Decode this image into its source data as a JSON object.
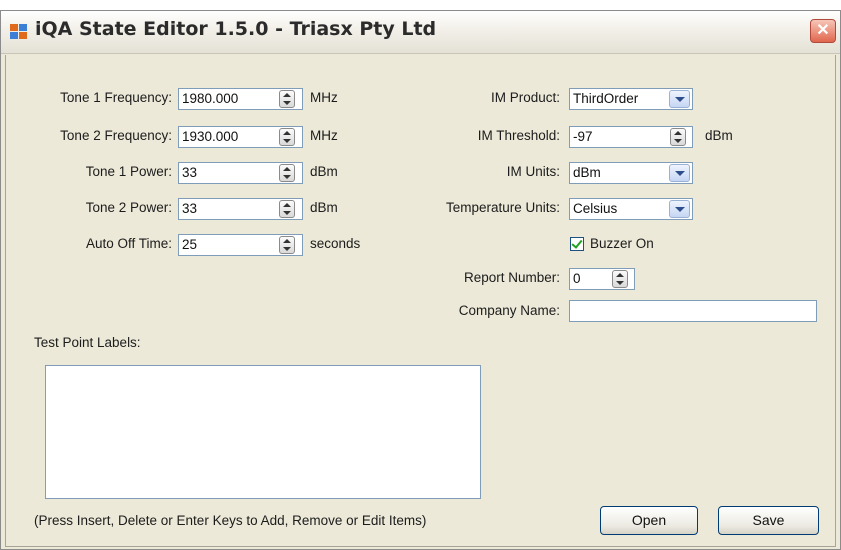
{
  "window": {
    "title": "iQA State Editor 1.5.0 - Triasx Pty Ltd",
    "close_glyph": "✕"
  },
  "left_fields": [
    {
      "label": "Tone 1 Frequency:",
      "value": "1980.000",
      "unit": "MHz"
    },
    {
      "label": "Tone 2 Frequency:",
      "value": "1930.000",
      "unit": "MHz"
    },
    {
      "label": "Tone 1 Power:",
      "value": "33",
      "unit": "dBm"
    },
    {
      "label": "Tone 2 Power:",
      "value": "33",
      "unit": "dBm"
    },
    {
      "label": "Auto Off Time:",
      "value": "25",
      "unit": "seconds"
    }
  ],
  "right_fields": {
    "im_product": {
      "label": "IM Product:",
      "value": "ThirdOrder"
    },
    "im_threshold": {
      "label": "IM Threshold:",
      "value": "-97",
      "unit": "dBm"
    },
    "im_units": {
      "label": "IM Units:",
      "value": "dBm"
    },
    "temperature_units": {
      "label": "Temperature Units:",
      "value": "Celsius"
    },
    "buzzer": {
      "label": "Buzzer On",
      "checked": true
    },
    "report_number": {
      "label": "Report Number:",
      "value": "0"
    },
    "company_name": {
      "label": "Company Name:",
      "value": ""
    }
  },
  "test_points": {
    "label": "Test Point Labels:",
    "hint": "(Press Insert, Delete or Enter Keys to Add, Remove or Edit Items)"
  },
  "buttons": {
    "open": "Open",
    "save": "Save"
  },
  "colors": {
    "accent_border": "#7f9db9",
    "button_border": "#003c74",
    "background": "#ece9d8"
  }
}
